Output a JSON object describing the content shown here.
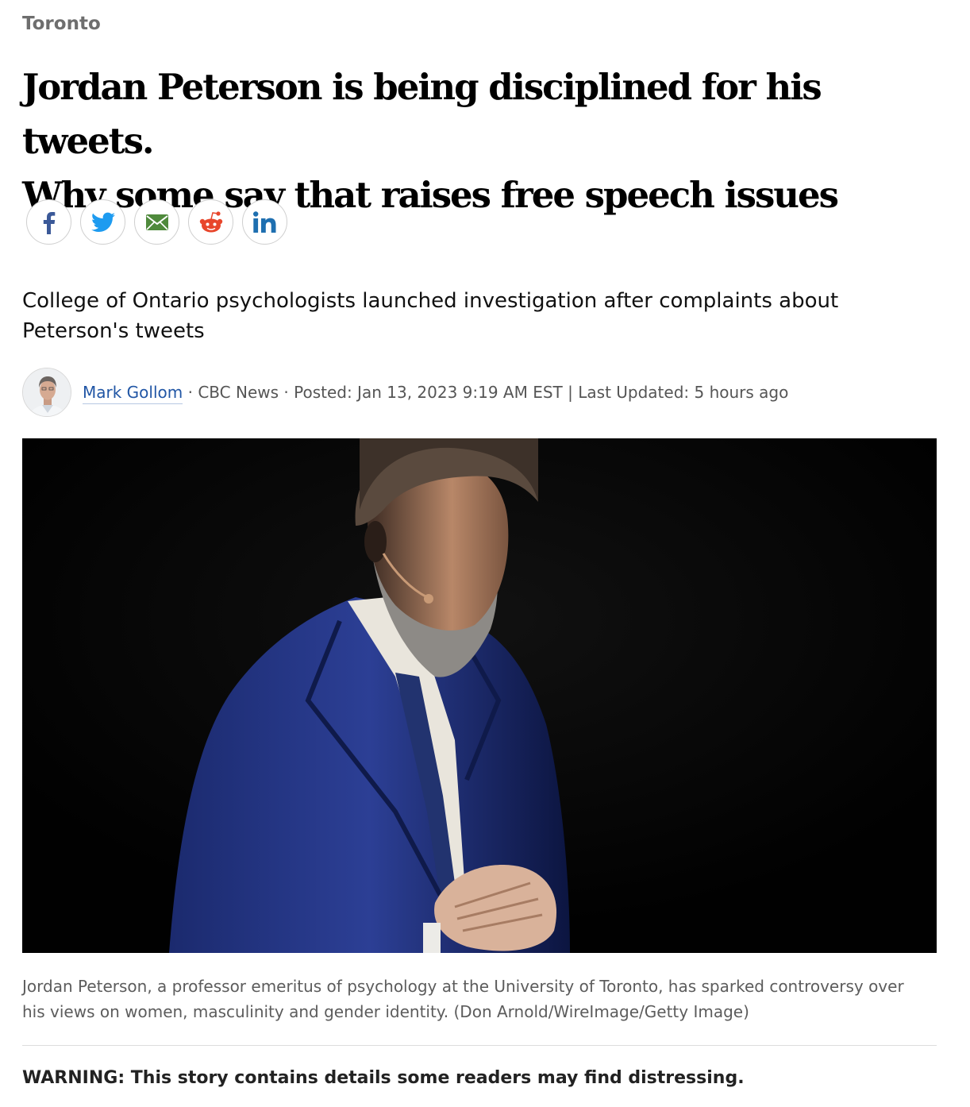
{
  "section": {
    "label": "Toronto"
  },
  "article": {
    "headline_line1": "Jordan Peterson is being disciplined for his tweets.",
    "headline_line2": "Why some say that raises free speech issues",
    "deck": "College of Ontario psychologists launched investigation after complaints about Peterson's tweets",
    "caption": "Jordan Peterson, a professor emeritus of psychology at the University of Toronto, has sparked controversy over his views on women, masculinity and gender identity. (Don Arnold/WireImage/Getty Image)",
    "warning": "WARNING: This story contains details some readers may find distressing."
  },
  "share": {
    "buttons": [
      {
        "network": "facebook",
        "icon": "facebook-icon",
        "color": "#3b5998"
      },
      {
        "network": "twitter",
        "icon": "twitter-icon",
        "color": "#1d9bf0"
      },
      {
        "network": "email",
        "icon": "mail-icon",
        "color": "#4f8a3c"
      },
      {
        "network": "reddit",
        "icon": "reddit-icon",
        "color": "#e8462b"
      },
      {
        "network": "linkedin",
        "icon": "linkedin-icon",
        "color": "#1e6fb0"
      }
    ]
  },
  "byline": {
    "author": "Mark Gollom",
    "outlet": "· CBC News ·",
    "posted": "Posted: Jan 13, 2023 9:19 AM EST",
    "separator": "|",
    "updated": "Last Updated: 5 hours ago"
  },
  "colors": {
    "author_link": "#2156a5",
    "section_label": "#6e6e6e",
    "hero_background": "#010101"
  }
}
